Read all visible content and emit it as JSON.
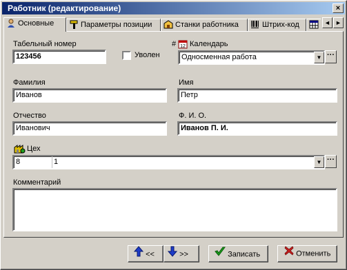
{
  "window": {
    "title": "Работник (редактирование)",
    "close": "×"
  },
  "tabs": [
    {
      "label": "Основные",
      "icon": "person-icon"
    },
    {
      "label": "Параметры позиции",
      "icon": "hammer-icon"
    },
    {
      "label": "Станки работника",
      "icon": "machine-icon"
    },
    {
      "label": "Штрих-код",
      "icon": "barcode-icon"
    },
    {
      "label": "",
      "icon": "table-icon"
    }
  ],
  "tab_scroll": {
    "left": "◄",
    "right": "►"
  },
  "form": {
    "tabel_label": "Табельный номер",
    "tabel_value": "123456",
    "fired_label": "Уволен",
    "calendar_prefix": "#",
    "calendar_label": "Календарь",
    "calendar_value": "Односменная работа",
    "surname_label": "Фамилия",
    "surname_value": "Иванов",
    "name_label": "Имя",
    "name_value": "Петр",
    "patronymic_label": "Отчество",
    "patronymic_value": "Иванович",
    "fio_label": "Ф. И. О.",
    "fio_value": "Иванов П. И.",
    "shop_label": "Цех",
    "shop_code": "8",
    "shop_name": "1",
    "comment_label": "Комментарий",
    "comment_value": "",
    "dropdown_glyph": "▼",
    "ellipsis": "···"
  },
  "buttons": {
    "prev": "<<",
    "next": ">>",
    "save": "Записать",
    "cancel": "Отменить"
  },
  "colors": {
    "title_start": "#0a246a",
    "title_end": "#a6caf0",
    "face": "#d4d0c8",
    "arrow_blue": "#1e3cc8",
    "check_green": "#1a9e1a",
    "cross_red": "#c81e1e"
  }
}
